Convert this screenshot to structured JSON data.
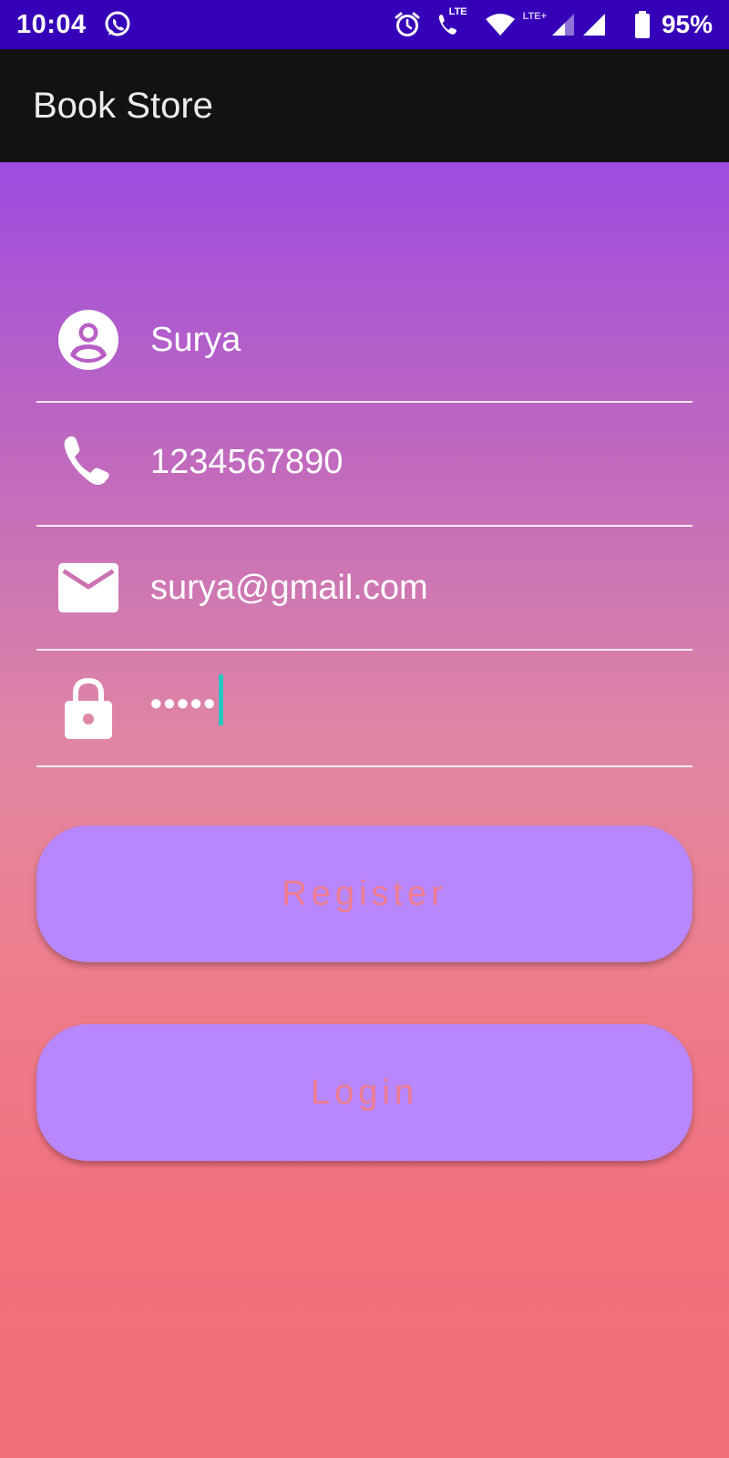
{
  "status_bar": {
    "time": "10:04",
    "lte_label": "LTE",
    "lte_plus_label": "LTE+",
    "battery_percent": "95%",
    "icons": [
      "whatsapp-icon",
      "alarm-icon",
      "volte-call-icon",
      "wifi-icon",
      "cell-signal-icon",
      "cell-signal-icon",
      "battery-icon"
    ]
  },
  "app_bar": {
    "title": "Book Store"
  },
  "form": {
    "name": {
      "value": "Surya",
      "icon": "account-circle-icon"
    },
    "phone": {
      "value": "1234567890",
      "icon": "phone-icon"
    },
    "email": {
      "value": "surya@gmail.com",
      "icon": "email-icon"
    },
    "password": {
      "value": "•••••",
      "icon": "lock-icon"
    }
  },
  "buttons": {
    "register_label": "Register",
    "login_label": "Login"
  },
  "colors": {
    "status_bar": "#3500b8",
    "app_bar": "#121212",
    "gradient_top": "#9d4ce0",
    "gradient_bottom": "#f26d7a",
    "button_bg": "#b886fd",
    "button_text": "#ee7b8e",
    "caret": "#26c6c0"
  }
}
